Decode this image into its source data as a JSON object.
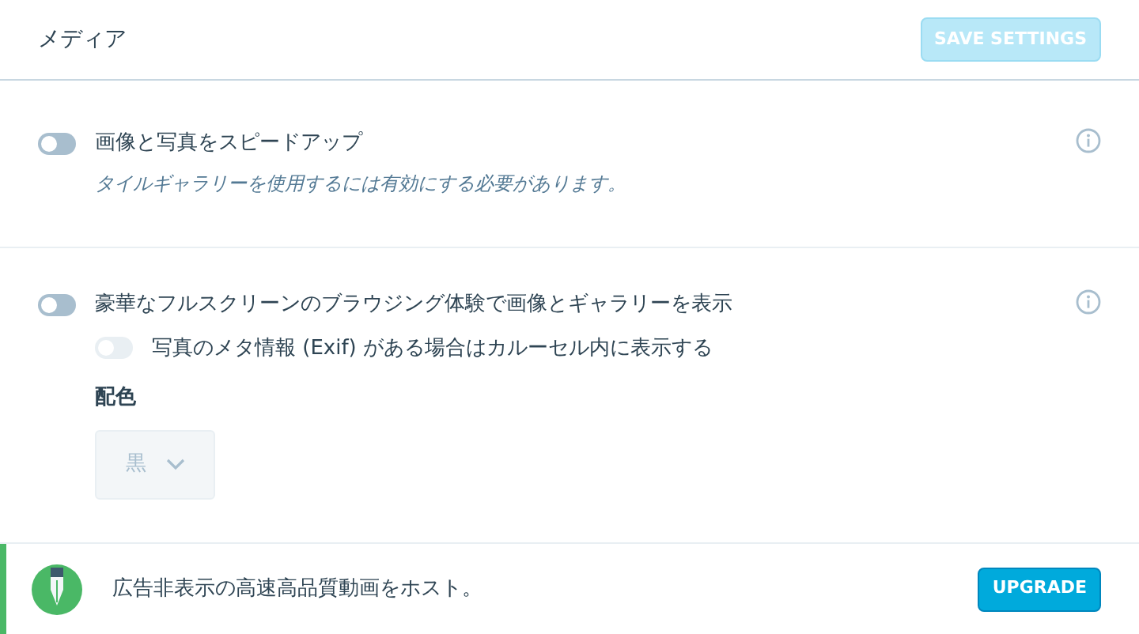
{
  "header": {
    "title": "メディア",
    "save_button": {
      "label": "SAVE SETTINGS",
      "disabled": true
    }
  },
  "settings": [
    {
      "label": "画像と写真をスピードアップ",
      "on": false,
      "disabled": false,
      "description": "タイルギャラリーを使用するには有効にする必要があります。",
      "info": true
    },
    {
      "label": "豪華なフルスクリーンのブラウジング体験で画像とギャラリーを表示",
      "on": false,
      "disabled": false,
      "info": true,
      "sub_toggle": {
        "label": "写真のメタ情報 (Exif) がある場合はカルーセル内に表示する",
        "on": false,
        "disabled": true
      },
      "color_select": {
        "label": "配色",
        "value": "黒",
        "disabled": true
      }
    }
  ],
  "banner": {
    "text": "広告非表示の高速高品質動画をホスト。",
    "button": "UPGRADE"
  }
}
